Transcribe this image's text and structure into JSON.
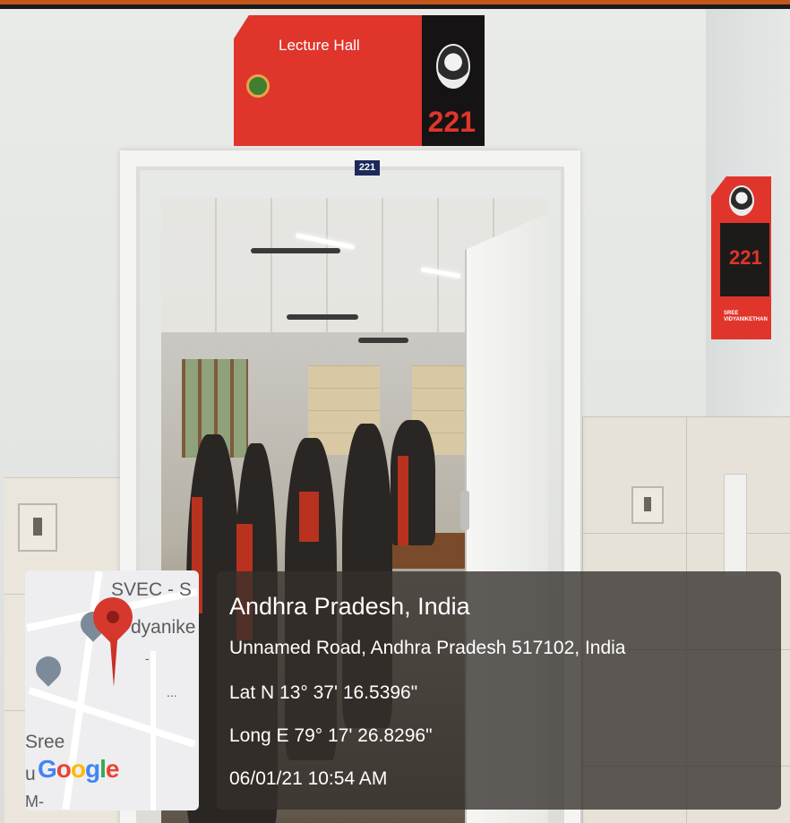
{
  "sign": {
    "title": "Lecture Hall",
    "room_number": "221",
    "door_plate": "221",
    "side_room_number": "221",
    "side_caption": "SREE VIDYANIKETHAN"
  },
  "map": {
    "label_top": "SVEC - S",
    "label_mid": "dyanike",
    "label_dash": "-",
    "label_dots": "...",
    "label_bottom": "Sree",
    "label_u": "u",
    "label_m": "M-",
    "google_letters": [
      "G",
      "o",
      "o",
      "g",
      "l",
      "e"
    ],
    "pin_icon": "map-pin-icon",
    "school_icon": "school-pin-icon"
  },
  "overlay": {
    "location": "Andhra Pradesh, India",
    "address": "Unnamed Road, Andhra Pradesh 517102, India",
    "latitude": "Lat N 13° 37' 16.5396\"",
    "longitude": "Long E 79° 17' 26.8296\"",
    "timestamp": "06/01/21 10:54 AM"
  },
  "colors": {
    "border_accent": "#c2571b",
    "sign_red": "#e0352b",
    "pin_red": "#d7382d"
  }
}
